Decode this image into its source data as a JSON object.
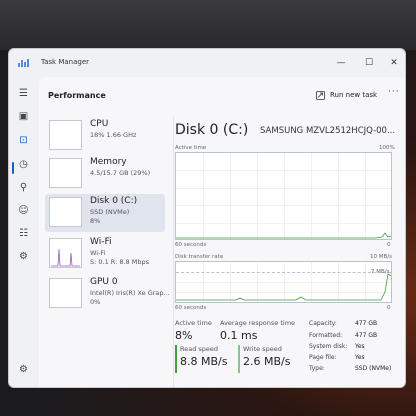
{
  "window": {
    "title": "Task Manager",
    "minimize": "—",
    "maximize": "☐",
    "close": "✕"
  },
  "header": {
    "title": "Performance",
    "run_new_task": "Run new task",
    "more": "···"
  },
  "nav": {
    "items": [
      {
        "name": "menu",
        "glyph": "☰"
      },
      {
        "name": "processes",
        "glyph": "▣"
      },
      {
        "name": "performance",
        "glyph": "⊡"
      },
      {
        "name": "app-history",
        "glyph": "◷"
      },
      {
        "name": "startup-apps",
        "glyph": "⚲"
      },
      {
        "name": "users",
        "glyph": "☺"
      },
      {
        "name": "details",
        "glyph": "☷"
      },
      {
        "name": "services",
        "glyph": "⚙"
      }
    ],
    "settings_glyph": "⚙"
  },
  "perf_items": [
    {
      "name": "CPU",
      "sub1": "18%  1.66 GHz",
      "sub2": ""
    },
    {
      "name": "Memory",
      "sub1": "4.5/15.7 GB (29%)",
      "sub2": ""
    },
    {
      "name": "Disk 0 (C:)",
      "sub1": "SSD (NVMe)",
      "sub2": "8%"
    },
    {
      "name": "Wi-Fi",
      "sub1": "Wi-Fi",
      "sub2": "S: 0.1  R: 8.8 Mbps"
    },
    {
      "name": "GPU 0",
      "sub1": "Intel(R) Iris(R) Xe Grap...",
      "sub2": "0%"
    }
  ],
  "detail": {
    "title": "Disk 0 (C:)",
    "model": "SAMSUNG MZVL2512HCJQ-00...",
    "active_time_label": "Active time",
    "active_time_max": "100%",
    "seconds_label_1": "60 seconds",
    "zero_label_1": "0",
    "transfer_label": "Disk transfer rate",
    "transfer_max": "10 MB/s",
    "transfer_mid": "7 MB/s",
    "seconds_label_2": "60 seconds",
    "zero_label_2": "0"
  },
  "stats": {
    "active_time_label": "Active time",
    "active_time_value": "8%",
    "avg_response_label": "Average response time",
    "avg_response_value": "0.1 ms",
    "read_speed_label": "Read speed",
    "read_speed_value": "8.8 MB/s",
    "write_speed_label": "Write speed",
    "write_speed_value": "2.6 MB/s"
  },
  "info": [
    {
      "label": "Capacity:",
      "value": "477 GB"
    },
    {
      "label": "Formatted:",
      "value": "477 GB"
    },
    {
      "label": "System disk:",
      "value": "Yes"
    },
    {
      "label": "Page file:",
      "value": "Yes"
    },
    {
      "label": "Type:",
      "value": "SSD (NVMe)"
    }
  ],
  "colors": {
    "accent": "#1a5fbf",
    "disk_line": "#3f9e3f",
    "read": "#3f9e3f",
    "write": "#3f9e3f"
  }
}
